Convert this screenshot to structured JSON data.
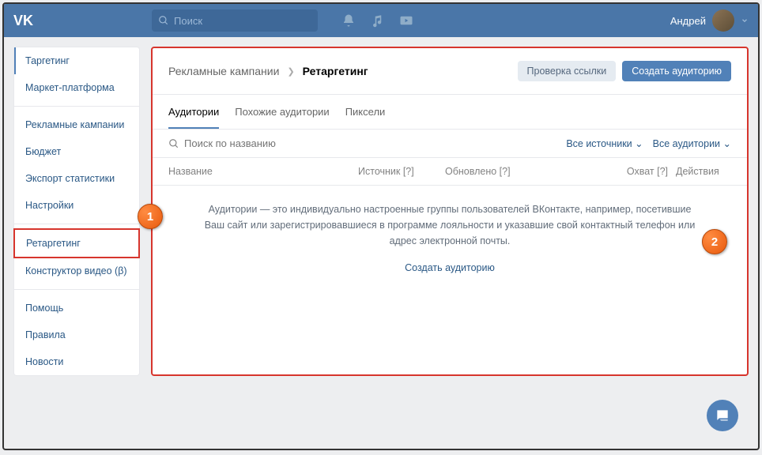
{
  "header": {
    "logo": "VK",
    "search_placeholder": "Поиск",
    "user_name": "Андрей"
  },
  "sidebar": {
    "groups": [
      [
        "Таргетинг",
        "Маркет-платформа"
      ],
      [
        "Рекламные кампании",
        "Бюджет",
        "Экспорт статистики",
        "Настройки"
      ],
      [
        "Ретаргетинг",
        "Конструктор видео (β)"
      ],
      [
        "Помощь",
        "Правила",
        "Новости"
      ]
    ],
    "active_index": 0,
    "highlighted": "Ретаргетинг"
  },
  "breadcrumb": {
    "parent": "Рекламные кампании",
    "current": "Ретаргетинг",
    "btn_check": "Проверка ссылки",
    "btn_create": "Создать аудиторию"
  },
  "tabs": {
    "items": [
      "Аудитории",
      "Похожие аудитории",
      "Пиксели"
    ],
    "active": 0
  },
  "filters": {
    "search_placeholder": "Поиск по названию",
    "sources": "Все источники",
    "audiences": "Все аудитории"
  },
  "table": {
    "headers": {
      "name": "Название",
      "source": "Источник [?]",
      "updated": "Обновлено [?]",
      "reach": "Охват [?]",
      "actions": "Действия"
    }
  },
  "empty": {
    "text": "Аудитории — это индивидуально настроенные группы пользователей ВКонтакте, например, посетившие Ваш сайт или зарегистрировавшиеся в программе лояльности и указавшие свой контактный телефон или адрес электронной почты.",
    "link": "Создать аудиторию"
  },
  "callouts": {
    "one": "1",
    "two": "2"
  }
}
